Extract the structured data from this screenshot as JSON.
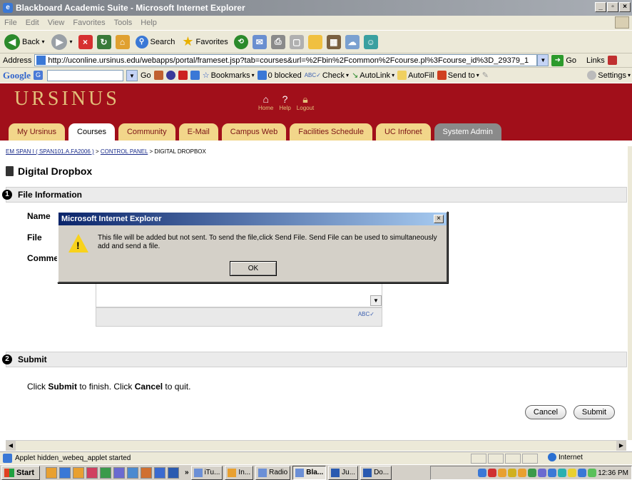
{
  "window": {
    "title": "Blackboard Academic Suite - Microsoft Internet Explorer",
    "controls": [
      "_",
      "×"
    ]
  },
  "menu": [
    "File",
    "Edit",
    "View",
    "Favorites",
    "Tools",
    "Help"
  ],
  "toolbar": {
    "back_label": "Back",
    "search_label": "Search",
    "favorites_label": "Favorites"
  },
  "address": {
    "label": "Address",
    "url": "http://uconline.ursinus.edu/webapps/portal/frameset.jsp?tab=courses&url=%2Fbin%2Fcommon%2Fcourse.pl%3Fcourse_id%3D_29379_1",
    "go_label": "Go",
    "links_label": "Links"
  },
  "googlebar": {
    "logo": "Google",
    "go_label": "Go",
    "bookmarks_label": "Bookmarks",
    "blocked_label": "0 blocked",
    "check_label": "Check",
    "autolink_label": "AutoLink",
    "autofill_label": "AutoFill",
    "sendto_label": "Send to",
    "settings_label": "Settings"
  },
  "site": {
    "logo": "URSINUS",
    "top_links": [
      {
        "label": "Home",
        "icon": "home-icon"
      },
      {
        "label": "Help",
        "icon": "help-icon"
      },
      {
        "label": "Logout",
        "icon": "logout-icon"
      }
    ],
    "tabs": [
      {
        "label": "My Ursinus"
      },
      {
        "label": "Courses"
      },
      {
        "label": "Community"
      },
      {
        "label": "E-Mail"
      },
      {
        "label": "Campus Web"
      },
      {
        "label": "Facilities Schedule"
      },
      {
        "label": "UC Infonet"
      },
      {
        "label": "System Admin"
      }
    ],
    "active_tab": "Courses"
  },
  "breadcrumb": {
    "course": "EM SPAN I ( SPAN101.A.FA2006 )",
    "sep": " > ",
    "control_panel": "CONTROL PANEL",
    "current": "DIGITAL DROPBOX"
  },
  "page": {
    "title": "Digital Dropbox",
    "section1": {
      "num": "1",
      "title": "File Information"
    },
    "fields": {
      "name": "Name",
      "file": "File",
      "comments": "Comme"
    },
    "section2": {
      "num": "2",
      "title": "Submit"
    },
    "instr_pre": "Click ",
    "instr_submit": "Submit",
    "instr_mid": " to finish. Click ",
    "instr_cancel": "Cancel",
    "instr_post": " to quit.",
    "cancel_label": "Cancel",
    "submit_label": "Submit",
    "spell_label": "ABC"
  },
  "dialog": {
    "title": "Microsoft Internet Explorer",
    "close": "×",
    "message": "This file will be added but not sent. To send the file,click Send File. Send File can be used to simultaneously add and send a file.",
    "ok_label": "OK"
  },
  "status": {
    "text": "Applet hidden_webeq_applet started",
    "zone": "Internet"
  },
  "taskbar": {
    "start_label": "Start",
    "tasks": [
      "iTu...",
      "In...",
      "Radio",
      "Bla...",
      "Ju...",
      "Do..."
    ],
    "clock": "12:36 PM"
  }
}
